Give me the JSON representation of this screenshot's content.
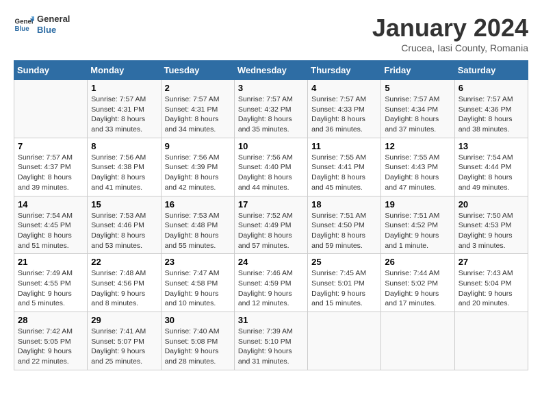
{
  "logo": {
    "line1": "General",
    "line2": "Blue"
  },
  "title": "January 2024",
  "subtitle": "Crucea, Iasi County, Romania",
  "weekdays": [
    "Sunday",
    "Monday",
    "Tuesday",
    "Wednesday",
    "Thursday",
    "Friday",
    "Saturday"
  ],
  "weeks": [
    [
      {
        "day": "",
        "info": ""
      },
      {
        "day": "1",
        "info": "Sunrise: 7:57 AM\nSunset: 4:31 PM\nDaylight: 8 hours\nand 33 minutes."
      },
      {
        "day": "2",
        "info": "Sunrise: 7:57 AM\nSunset: 4:31 PM\nDaylight: 8 hours\nand 34 minutes."
      },
      {
        "day": "3",
        "info": "Sunrise: 7:57 AM\nSunset: 4:32 PM\nDaylight: 8 hours\nand 35 minutes."
      },
      {
        "day": "4",
        "info": "Sunrise: 7:57 AM\nSunset: 4:33 PM\nDaylight: 8 hours\nand 36 minutes."
      },
      {
        "day": "5",
        "info": "Sunrise: 7:57 AM\nSunset: 4:34 PM\nDaylight: 8 hours\nand 37 minutes."
      },
      {
        "day": "6",
        "info": "Sunrise: 7:57 AM\nSunset: 4:36 PM\nDaylight: 8 hours\nand 38 minutes."
      }
    ],
    [
      {
        "day": "7",
        "info": "Sunrise: 7:57 AM\nSunset: 4:37 PM\nDaylight: 8 hours\nand 39 minutes."
      },
      {
        "day": "8",
        "info": "Sunrise: 7:56 AM\nSunset: 4:38 PM\nDaylight: 8 hours\nand 41 minutes."
      },
      {
        "day": "9",
        "info": "Sunrise: 7:56 AM\nSunset: 4:39 PM\nDaylight: 8 hours\nand 42 minutes."
      },
      {
        "day": "10",
        "info": "Sunrise: 7:56 AM\nSunset: 4:40 PM\nDaylight: 8 hours\nand 44 minutes."
      },
      {
        "day": "11",
        "info": "Sunrise: 7:55 AM\nSunset: 4:41 PM\nDaylight: 8 hours\nand 45 minutes."
      },
      {
        "day": "12",
        "info": "Sunrise: 7:55 AM\nSunset: 4:43 PM\nDaylight: 8 hours\nand 47 minutes."
      },
      {
        "day": "13",
        "info": "Sunrise: 7:54 AM\nSunset: 4:44 PM\nDaylight: 8 hours\nand 49 minutes."
      }
    ],
    [
      {
        "day": "14",
        "info": "Sunrise: 7:54 AM\nSunset: 4:45 PM\nDaylight: 8 hours\nand 51 minutes."
      },
      {
        "day": "15",
        "info": "Sunrise: 7:53 AM\nSunset: 4:46 PM\nDaylight: 8 hours\nand 53 minutes."
      },
      {
        "day": "16",
        "info": "Sunrise: 7:53 AM\nSunset: 4:48 PM\nDaylight: 8 hours\nand 55 minutes."
      },
      {
        "day": "17",
        "info": "Sunrise: 7:52 AM\nSunset: 4:49 PM\nDaylight: 8 hours\nand 57 minutes."
      },
      {
        "day": "18",
        "info": "Sunrise: 7:51 AM\nSunset: 4:50 PM\nDaylight: 8 hours\nand 59 minutes."
      },
      {
        "day": "19",
        "info": "Sunrise: 7:51 AM\nSunset: 4:52 PM\nDaylight: 9 hours\nand 1 minute."
      },
      {
        "day": "20",
        "info": "Sunrise: 7:50 AM\nSunset: 4:53 PM\nDaylight: 9 hours\nand 3 minutes."
      }
    ],
    [
      {
        "day": "21",
        "info": "Sunrise: 7:49 AM\nSunset: 4:55 PM\nDaylight: 9 hours\nand 5 minutes."
      },
      {
        "day": "22",
        "info": "Sunrise: 7:48 AM\nSunset: 4:56 PM\nDaylight: 9 hours\nand 8 minutes."
      },
      {
        "day": "23",
        "info": "Sunrise: 7:47 AM\nSunset: 4:58 PM\nDaylight: 9 hours\nand 10 minutes."
      },
      {
        "day": "24",
        "info": "Sunrise: 7:46 AM\nSunset: 4:59 PM\nDaylight: 9 hours\nand 12 minutes."
      },
      {
        "day": "25",
        "info": "Sunrise: 7:45 AM\nSunset: 5:01 PM\nDaylight: 9 hours\nand 15 minutes."
      },
      {
        "day": "26",
        "info": "Sunrise: 7:44 AM\nSunset: 5:02 PM\nDaylight: 9 hours\nand 17 minutes."
      },
      {
        "day": "27",
        "info": "Sunrise: 7:43 AM\nSunset: 5:04 PM\nDaylight: 9 hours\nand 20 minutes."
      }
    ],
    [
      {
        "day": "28",
        "info": "Sunrise: 7:42 AM\nSunset: 5:05 PM\nDaylight: 9 hours\nand 22 minutes."
      },
      {
        "day": "29",
        "info": "Sunrise: 7:41 AM\nSunset: 5:07 PM\nDaylight: 9 hours\nand 25 minutes."
      },
      {
        "day": "30",
        "info": "Sunrise: 7:40 AM\nSunset: 5:08 PM\nDaylight: 9 hours\nand 28 minutes."
      },
      {
        "day": "31",
        "info": "Sunrise: 7:39 AM\nSunset: 5:10 PM\nDaylight: 9 hours\nand 31 minutes."
      },
      {
        "day": "",
        "info": ""
      },
      {
        "day": "",
        "info": ""
      },
      {
        "day": "",
        "info": ""
      }
    ]
  ]
}
